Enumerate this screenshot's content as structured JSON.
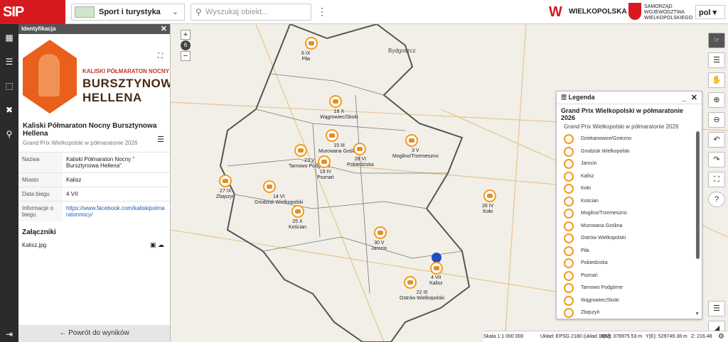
{
  "topbar": {
    "logo_text": "SIP",
    "theme_label": "Sport i turystyka",
    "search_placeholder": "Wyszukaj obiekt...",
    "wlkp_text": "WIELKOPOLSKA",
    "samorzad_text": "SAMORZĄD WOJEWÓDZTWA WIELKOPOLSKIEGO",
    "language": "pol"
  },
  "panel": {
    "header": "Identyfikacja",
    "banner_sub": "KALISKI PÓŁMARATON NOCNY",
    "banner_title_1": "BURSZTYNOWA",
    "banner_title_2": "HELLENA",
    "object_title": "Kaliski Półmaraton Nocny Bursztynowa Hellena",
    "object_layer": "Grand Prix Wielkopolski w półmaratonie 2026",
    "attributes": [
      {
        "key": "Nazwa",
        "value": "Kaliski Półmaraton Nocny \" Bursztynowa Hellena\""
      },
      {
        "key": "Miasto",
        "value": "Kalisz"
      },
      {
        "key": "Data biegu",
        "value": "4 VII"
      },
      {
        "key": "Informacje o biegu",
        "value": "https://www.facebook.com/kaliskipolmaratonnocy/"
      }
    ],
    "attachments_header": "Załączniki",
    "attachment_file": "Kalisz.jpg",
    "back_label": "Powrót do wyników"
  },
  "map": {
    "zoom_level": "6",
    "places": [
      "Bydgoszcz"
    ],
    "markers": [
      {
        "label1": "6 IX",
        "label2": "Piła"
      },
      {
        "label1": "18 X",
        "label2": "Wągrowiec/Skoki"
      },
      {
        "label1": "15 III",
        "label2": "Murowana Goślina"
      },
      {
        "label1": "28 VI",
        "label2": "Pobiedziska"
      },
      {
        "label1": "3 V",
        "label2": "Mogilno/Trzemeszno"
      },
      {
        "label1": "23 V",
        "label2": "Tarnowo Podgórne"
      },
      {
        "label1": "19 IV",
        "label2": "Poznań"
      },
      {
        "label1": "27 IX",
        "label2": "Zbąszyń"
      },
      {
        "label1": "14 VI",
        "label2": "Grodzisk Wielkopolski"
      },
      {
        "label1": "26 IV",
        "label2": "Koło"
      },
      {
        "label1": "25 X",
        "label2": "Kościan"
      },
      {
        "label1": "30 V",
        "label2": "Jarocin"
      },
      {
        "label1": "4 VII",
        "label2": "Kalisz"
      },
      {
        "label1": "22 III",
        "label2": "Ostrów Wielkopolski"
      }
    ]
  },
  "legend": {
    "header": "Legenda",
    "title": "Grand Prix Wielkopolski w półmaratonie 2026",
    "subtitle": "Grand Prix Wielkopolski w półmaratonie 2026",
    "items": [
      "Dziekanowice/Gniezno",
      "Grodzisk Wielkopolski",
      "Jarocin",
      "Kalisz",
      "Koło",
      "Kościan",
      "Mogilno/Trzemeszno",
      "Murowana Goślina",
      "Ostrów Wielkopolski",
      "Piła",
      "Pobiedziska",
      "Poznań",
      "Tarnowo Podgórne",
      "Wągrowiec/Skoki",
      "Zbąszyń"
    ]
  },
  "status": {
    "scale": "Skala 1:1 000 000",
    "crs": "Układ: EPSG 2180 (układ 1992)",
    "x": "X(N): 378975.53 m",
    "y": "Y(E): 529749.38 m",
    "z": "Z: 216.48"
  },
  "colors": {
    "brand": "#d71920",
    "marker": "#f29b1e",
    "boundary": "#555555"
  }
}
